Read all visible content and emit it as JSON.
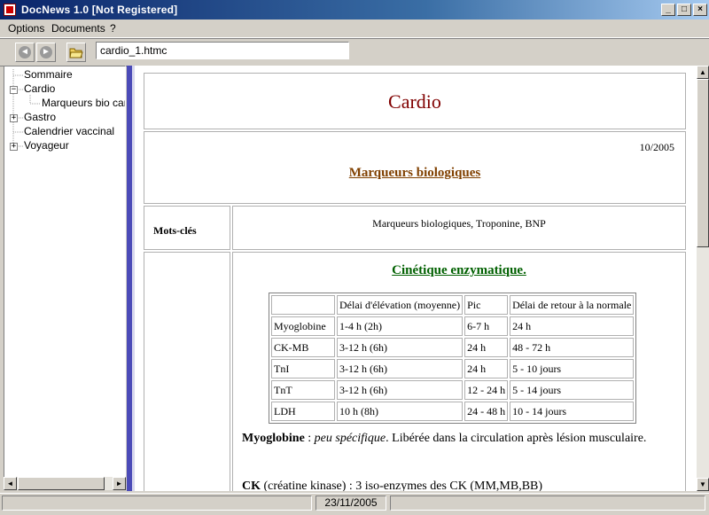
{
  "window": {
    "title": "DocNews 1.0  [Not Registered]",
    "min_glyph": "_",
    "max_glyph": "□",
    "close_glyph": "×"
  },
  "menu": {
    "items": [
      "Options",
      "Documents",
      "?"
    ]
  },
  "toolbar": {
    "back_glyph": "◄",
    "forward_glyph": "►",
    "address_value": "cardio_1.htmc"
  },
  "tree": {
    "items": [
      {
        "label": "Sommaire",
        "expander": ""
      },
      {
        "label": "Cardio",
        "expander": "−"
      },
      {
        "label": "Marqueurs bio cardi",
        "expander": ""
      },
      {
        "label": "Gastro",
        "expander": "+"
      },
      {
        "label": "Calendrier vaccinal",
        "expander": ""
      },
      {
        "label": "Voyageur",
        "expander": "+"
      }
    ]
  },
  "doc": {
    "title": "Cardio",
    "date": "10/2005",
    "subtitle": "Marqueurs biologiques",
    "keywords_label": "Mots-clés",
    "keywords_value": "Marqueurs biologiques, Troponine, BNP",
    "section_title": "Cinétique enzymatique.",
    "table": {
      "headers": [
        "",
        "Délai d'élévation (moyenne)",
        "Pic",
        "Délai de retour à la normale"
      ],
      "rows": [
        [
          "Myoglobine",
          "1-4 h (2h)",
          "6-7 h",
          "24 h"
        ],
        [
          "CK-MB",
          "3-12 h (6h)",
          "24 h",
          "48 - 72 h"
        ],
        [
          "TnI",
          "3-12 h (6h)",
          "24 h",
          "5 - 10 jours"
        ],
        [
          "TnT",
          "3-12 h (6h)",
          "12 - 24 h",
          "5 - 14 jours"
        ],
        [
          "LDH",
          "10 h (8h)",
          "24 - 48 h",
          "10 - 14 jours"
        ]
      ]
    },
    "para1": {
      "term": "Myoglobine",
      "sep": " : ",
      "italic": "peu spécifique",
      "rest": ". Libérée dans la circulation après lésion musculaire."
    },
    "para2": {
      "term": "CK",
      "rest": " (créatine kinase) : 3 iso-enzymes des CK (MM,MB,BB)"
    }
  },
  "status": {
    "date": "23/11/2005"
  }
}
